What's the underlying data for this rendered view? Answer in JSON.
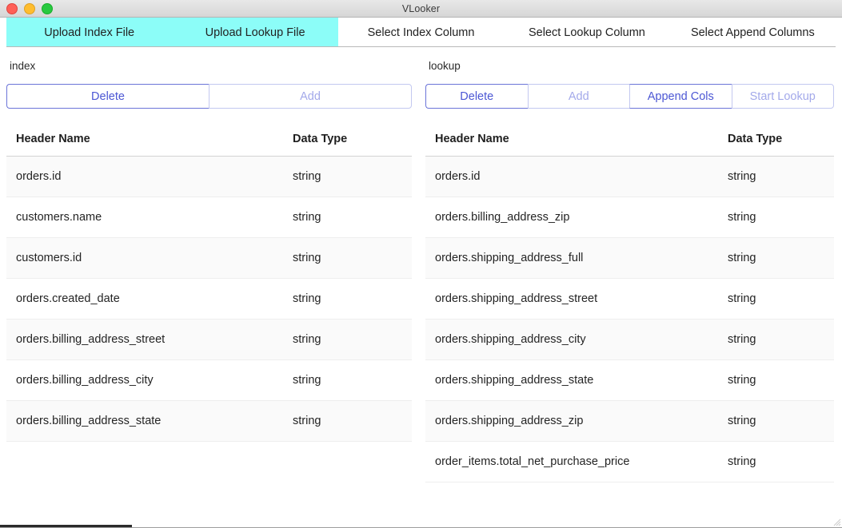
{
  "window": {
    "title": "VLooker",
    "traffic_lights": [
      "close",
      "minimize",
      "maximize"
    ]
  },
  "colors": {
    "tab_selected_bg": "#8cfdf8",
    "button_enabled_text": "#4c57d4",
    "button_enabled_border": "#6b74d8",
    "button_disabled_text": "#a3a9ea",
    "button_disabled_border": "#c3c8f0",
    "row_stripe_bg": "#fafafa",
    "row_plain_bg": "#ffffff",
    "titlebar_bg": "#dededE"
  },
  "tabs": [
    {
      "label": "Upload Index File",
      "selected": true
    },
    {
      "label": "Upload Lookup File",
      "selected": true
    },
    {
      "label": "Select Index Column",
      "selected": false
    },
    {
      "label": "Select Lookup Column",
      "selected": false
    },
    {
      "label": "Select Append Columns",
      "selected": false
    }
  ],
  "index_panel": {
    "label": "index",
    "buttons": [
      {
        "label": "Delete",
        "enabled": true
      },
      {
        "label": "Add",
        "enabled": false
      }
    ],
    "table": {
      "columns": [
        "Header Name",
        "Data Type"
      ],
      "rows": [
        {
          "name": "orders.id",
          "type": "string"
        },
        {
          "name": "customers.name",
          "type": "string"
        },
        {
          "name": "customers.id",
          "type": "string"
        },
        {
          "name": "orders.created_date",
          "type": "string"
        },
        {
          "name": "orders.billing_address_street",
          "type": "string"
        },
        {
          "name": "orders.billing_address_city",
          "type": "string"
        },
        {
          "name": "orders.billing_address_state",
          "type": "string"
        }
      ]
    }
  },
  "lookup_panel": {
    "label": "lookup",
    "buttons": [
      {
        "label": "Delete",
        "enabled": true
      },
      {
        "label": "Add",
        "enabled": false
      },
      {
        "label": "Append Cols",
        "enabled": true
      },
      {
        "label": "Start Lookup",
        "enabled": false
      }
    ],
    "table": {
      "columns": [
        "Header Name",
        "Data Type"
      ],
      "rows": [
        {
          "name": "orders.id",
          "type": "string"
        },
        {
          "name": "orders.billing_address_zip",
          "type": "string"
        },
        {
          "name": "orders.shipping_address_full",
          "type": "string"
        },
        {
          "name": "orders.shipping_address_street",
          "type": "string"
        },
        {
          "name": "orders.shipping_address_city",
          "type": "string"
        },
        {
          "name": "orders.shipping_address_state",
          "type": "string"
        },
        {
          "name": "orders.shipping_address_zip",
          "type": "string"
        },
        {
          "name": "order_items.total_net_purchase_price",
          "type": "string"
        }
      ]
    }
  }
}
